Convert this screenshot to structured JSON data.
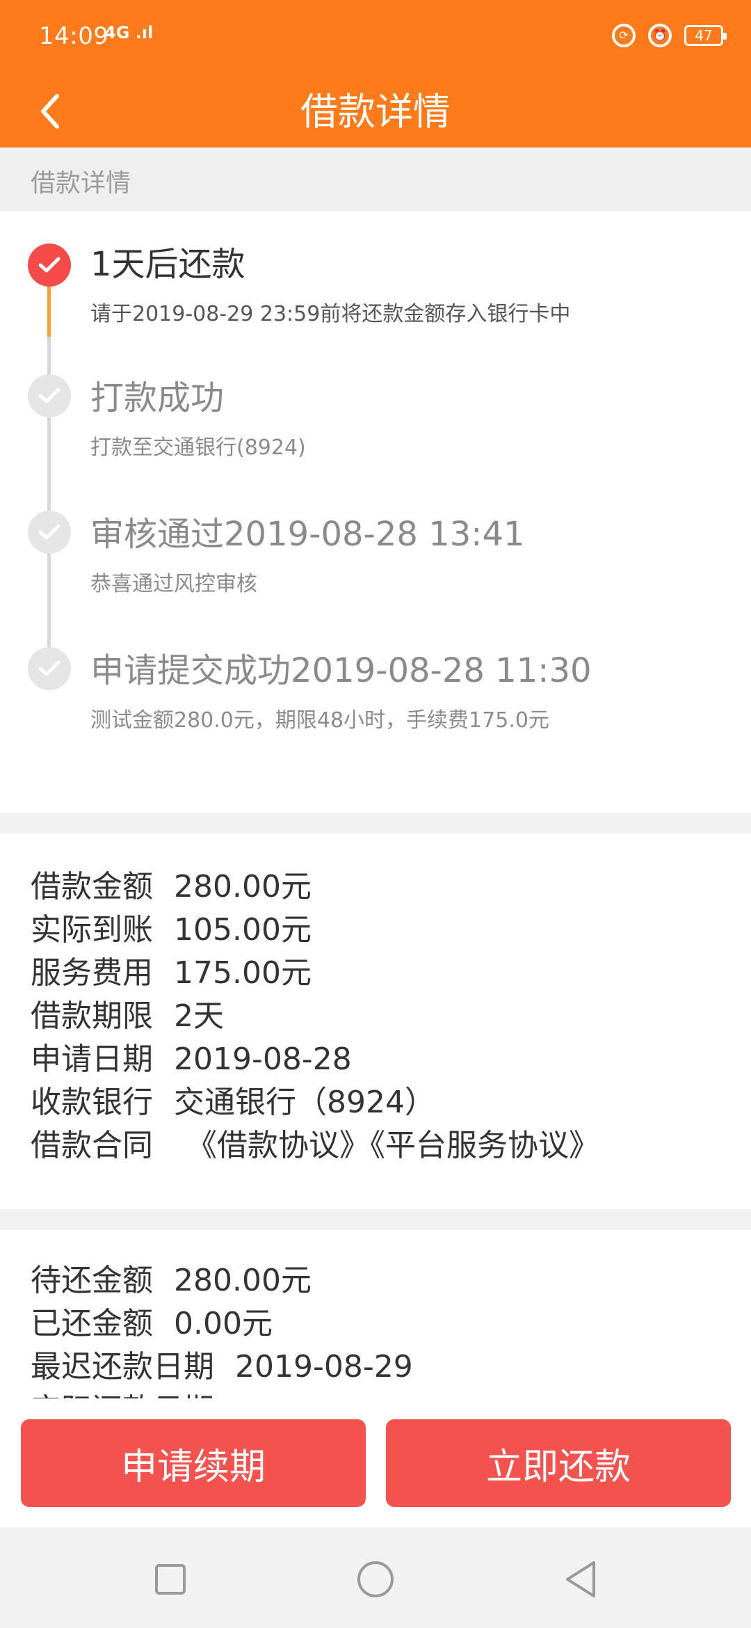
{
  "status_bar": {
    "time": "14:09",
    "signal": "4G .ıl",
    "battery": "47"
  },
  "header": {
    "title": "借款详情"
  },
  "section": {
    "label": "借款详情"
  },
  "timeline": [
    {
      "title": "1天后还款",
      "desc": "请于2019-08-29 23:59前将还款金额存入银行卡中",
      "state": "active"
    },
    {
      "title": "打款成功",
      "desc": "打款至交通银行(8924)",
      "state": "done"
    },
    {
      "title": "审核通过2019-08-28 13:41",
      "desc": "恭喜通过风控审核",
      "state": "done"
    },
    {
      "title": "申请提交成功2019-08-28 11:30",
      "desc": "测试金额280.0元，期限48小时，手续费175.0元",
      "state": "done"
    }
  ],
  "loan_info": [
    {
      "label": "借款金额",
      "value": "280.00元"
    },
    {
      "label": "实际到账",
      "value": "105.00元"
    },
    {
      "label": "服务费用",
      "value": "175.00元"
    },
    {
      "label": "借款期限",
      "value": "2天"
    },
    {
      "label": "申请日期",
      "value": "2019-08-28"
    },
    {
      "label": "收款银行",
      "value": "交通银行（8924）"
    },
    {
      "label": "借款合同",
      "value": "《借款协议》《平台服务协议》"
    }
  ],
  "repay_info": [
    {
      "label": "待还金额",
      "value": "280.00元"
    },
    {
      "label": "已还金额",
      "value": "0.00元"
    },
    {
      "label": "最迟还款日期",
      "value": "2019-08-29"
    },
    {
      "label": "实际还款日期",
      "value": ""
    }
  ],
  "actions": {
    "renew": "申请续期",
    "repay": "立即还款"
  },
  "colors": {
    "header": "#ff7a1a",
    "accent": "#f44b49",
    "button": "#f4524f"
  }
}
